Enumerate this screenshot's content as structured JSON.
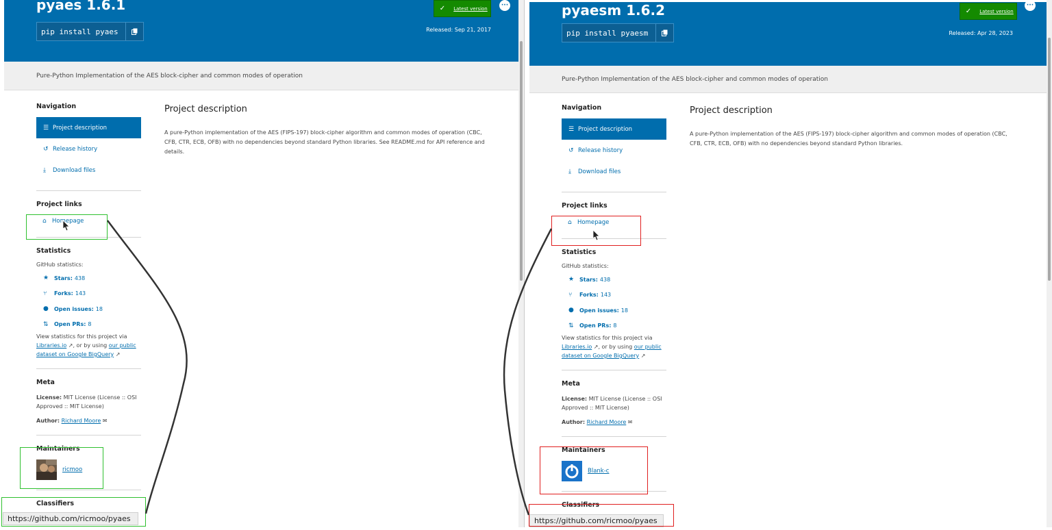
{
  "left": {
    "package_title": "pyaes 1.6.1",
    "pip_command": "pip install pyaes",
    "latest_version_label": "Latest version",
    "released": "Released: Sep 21, 2017",
    "summary": "Pure-Python Implementation of the AES block-cipher and common modes of operation",
    "navigation_heading": "Navigation",
    "nav": [
      "Project description",
      "Release history",
      "Download files"
    ],
    "project_links_heading": "Project links",
    "homepage_label": "Homepage",
    "statistics_heading": "Statistics",
    "github_stats_label": "GitHub statistics:",
    "stats": [
      {
        "label": "Stars:",
        "value": "438"
      },
      {
        "label": "Forks:",
        "value": "143"
      },
      {
        "label": "Open issues:",
        "value": "18"
      },
      {
        "label": "Open PRs:",
        "value": "8"
      }
    ],
    "view_stats_text": "View statistics for this project via",
    "libraries_io": "Libraries.io",
    "or_by_using": ", or by using",
    "bigquery_link": "our public dataset on Google BigQuery",
    "meta_heading": "Meta",
    "license_label": "License:",
    "license_value": "MIT License (License :: OSI Approved :: MIT License)",
    "author_label": "Author:",
    "author_value": "Richard Moore",
    "maintainers_heading": "Maintainers",
    "maintainer": "ricmoo",
    "classifiers_heading": "Classifiers",
    "main_heading": "Project description",
    "description": "A pure-Python implementation of the AES (FIPS-197) block-cipher algorithm and common modes of operation (CBC, CFB, CTR, ECB, OFB) with no dependencies beyond standard Python libraries. See README.md for API reference and details.",
    "status_url": "https://github.com/ricmoo/pyaes"
  },
  "right": {
    "package_title": "pyaesm 1.6.2",
    "pip_command": "pip install pyaesm",
    "latest_version_label": "Latest version",
    "released": "Released: Apr 28, 2023",
    "summary": "Pure-Python Implementation of the AES block-cipher and common modes of operation",
    "navigation_heading": "Navigation",
    "nav": [
      "Project description",
      "Release history",
      "Download files"
    ],
    "project_links_heading": "Project links",
    "homepage_label": "Homepage",
    "statistics_heading": "Statistics",
    "github_stats_label": "GitHub statistics:",
    "stats": [
      {
        "label": "Stars:",
        "value": "438"
      },
      {
        "label": "Forks:",
        "value": "143"
      },
      {
        "label": "Open issues:",
        "value": "18"
      },
      {
        "label": "Open PRs:",
        "value": "8"
      }
    ],
    "view_stats_text": "View statistics for this project via",
    "libraries_io": "Libraries.io",
    "or_by_using": ", or by using",
    "bigquery_link": "our public dataset on Google BigQuery",
    "meta_heading": "Meta",
    "license_label": "License:",
    "license_value": "MIT License (License :: OSI Approved :: MIT License)",
    "author_label": "Author:",
    "author_value": "Richard Moore",
    "maintainers_heading": "Maintainers",
    "maintainer": "Blank-c",
    "classifiers_heading": "Classifiers",
    "main_heading": "Project description",
    "description": "A pure-Python implementation of the AES (FIPS-197) block-cipher algorithm and common modes of operation (CBC, CFB, CTR, ECB, OFB) with no dependencies beyond standard Python libraries.",
    "status_url": "https://github.com/ricmoo/pyaes"
  },
  "colors": {
    "header_blue": "#006dad",
    "badge_green": "#148a00",
    "annotation_green": "#2ec02e",
    "annotation_red": "#e01e1e"
  },
  "icons": [
    "copy-icon",
    "check-icon",
    "menu-icon",
    "history-icon",
    "download-icon",
    "home-icon",
    "star-icon",
    "fork-icon",
    "issue-icon",
    "pull-request-icon",
    "external-link-icon",
    "mail-icon"
  ]
}
